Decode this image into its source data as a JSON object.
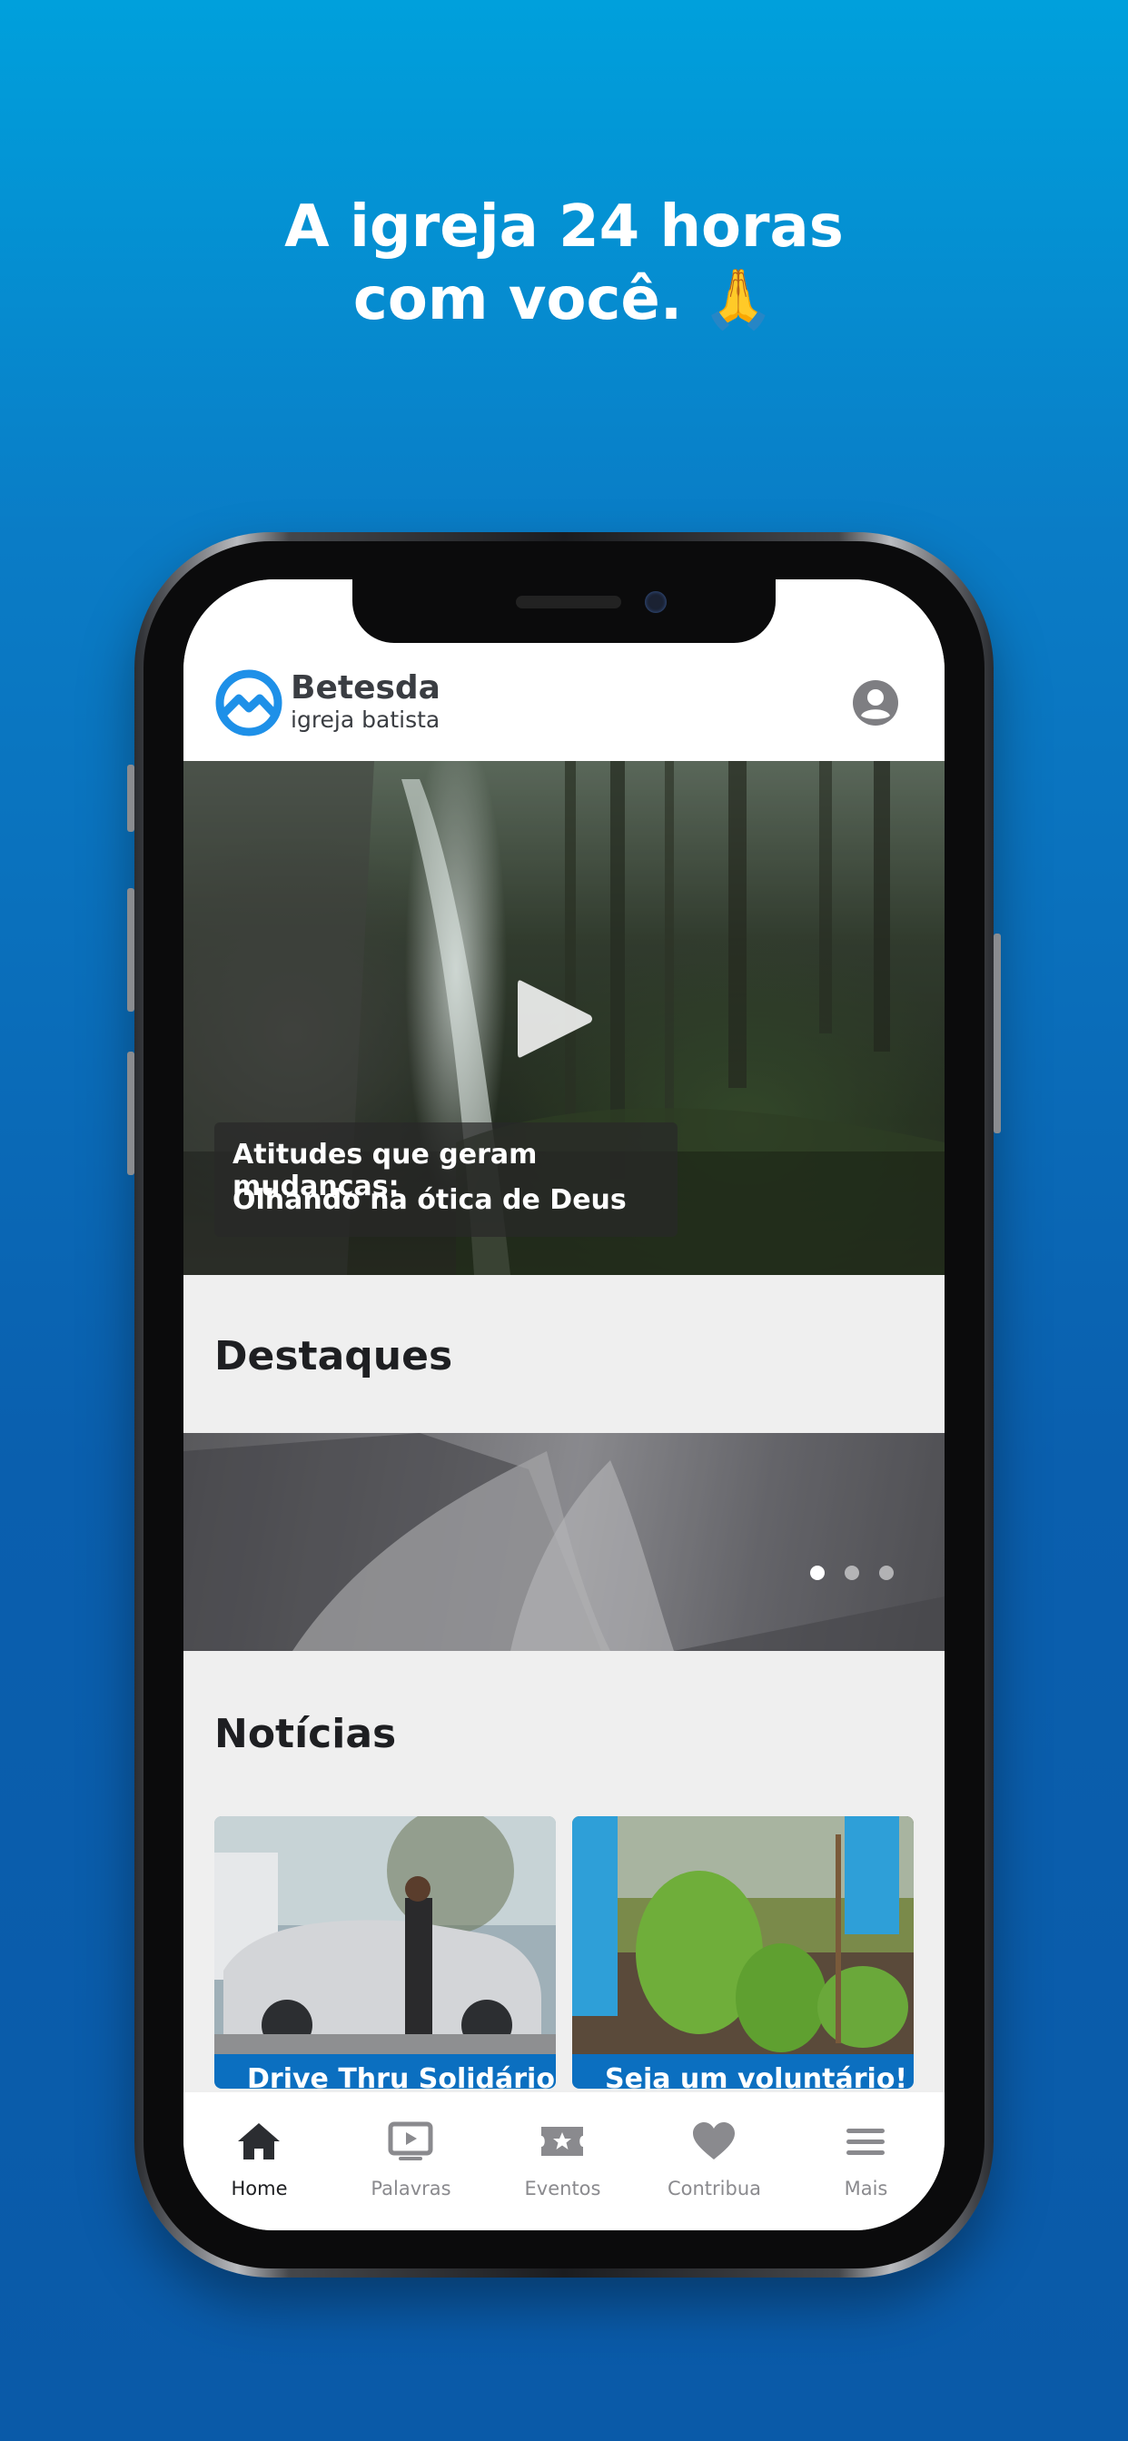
{
  "promo": {
    "headline_line1": "A igreja 24 horas",
    "headline_line2": "com você. 🙏"
  },
  "app": {
    "brand_name": "Betesda",
    "brand_subtitle": "igreja batista",
    "accent_color": "#0b6fc0"
  },
  "hero": {
    "caption_line1": "Atitudes que geram mudanças:",
    "caption_line2": "Olhando na ótica de Deus"
  },
  "highlights": {
    "title": "Destaques",
    "carousel_page_count": 3,
    "carousel_active_index": 0
  },
  "news": {
    "title": "Notícias",
    "items": [
      {
        "title": "Drive Thru Solidário"
      },
      {
        "title": "Seja um voluntário!"
      }
    ]
  },
  "tabbar": {
    "active_index": 0,
    "items": [
      {
        "label": "Home",
        "icon": "home-icon"
      },
      {
        "label": "Palavras",
        "icon": "video-play-icon"
      },
      {
        "label": "Eventos",
        "icon": "ticket-star-icon"
      },
      {
        "label": "Contribua",
        "icon": "heart-icon"
      },
      {
        "label": "Mais",
        "icon": "menu-icon"
      }
    ]
  }
}
